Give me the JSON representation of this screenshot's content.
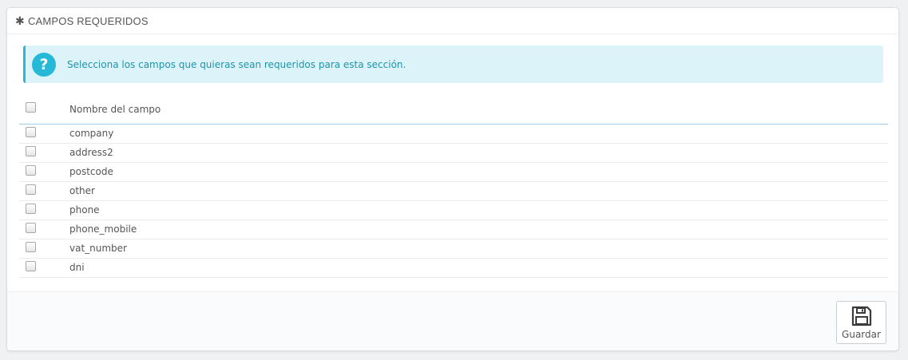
{
  "panel": {
    "title": "CAMPOS REQUERIDOS",
    "icon": "asterisk-icon"
  },
  "alert": {
    "icon": "question-circle-icon",
    "text": "Selecciona los campos que quieras sean requeridos para esta sección.",
    "color": "#25b9d7"
  },
  "table": {
    "header": "Nombre del campo",
    "rows": [
      {
        "name": "company",
        "checked": false
      },
      {
        "name": "address2",
        "checked": false
      },
      {
        "name": "postcode",
        "checked": false
      },
      {
        "name": "other",
        "checked": false
      },
      {
        "name": "phone",
        "checked": false
      },
      {
        "name": "phone_mobile",
        "checked": false
      },
      {
        "name": "vat_number",
        "checked": false
      },
      {
        "name": "dni",
        "checked": false
      }
    ]
  },
  "footer": {
    "save_label": "Guardar",
    "save_icon": "floppy-disk-icon"
  }
}
